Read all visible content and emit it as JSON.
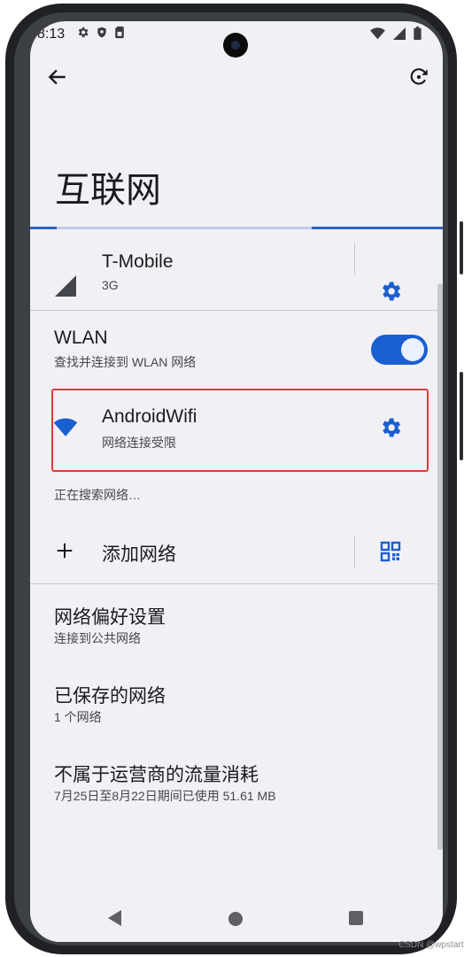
{
  "status_bar": {
    "time": "8:13",
    "left_icons": [
      "gear-icon",
      "shield-icon",
      "sim-card-icon"
    ],
    "right_icons": [
      "wifi-icon",
      "cellular-signal-icon",
      "battery-icon"
    ]
  },
  "toolbar": {
    "back_icon": "arrow-back-icon",
    "help_icon": "help-refresh-icon"
  },
  "page": {
    "title": "互联网"
  },
  "mobile_network": {
    "name": "T-Mobile",
    "subtitle": "3G",
    "signal_icon": "cellular-signal-icon",
    "settings_icon": "gear-icon"
  },
  "wlan": {
    "title": "WLAN",
    "subtitle": "查找并连接到 WLAN 网络",
    "toggle_on": true
  },
  "current_network": {
    "name": "AndroidWifi",
    "subtitle": "网络连接受限",
    "icon": "wifi-icon",
    "settings_icon": "gear-icon"
  },
  "searching_text": "正在搜索网络…",
  "add_network": {
    "label": "添加网络",
    "plus_icon": "plus-icon",
    "qr_icon": "qr-code-scan-icon"
  },
  "preferences": [
    {
      "title": "网络偏好设置",
      "subtitle": "连接到公共网络"
    },
    {
      "title": "已保存的网络",
      "subtitle": "1 个网络"
    },
    {
      "title": "不属于运营商的流量消耗",
      "subtitle": "7月25日至8月22日期间已使用 51.61 MB"
    }
  ],
  "nav_bar": {
    "back": "nav-back-icon",
    "home": "nav-home-icon",
    "recents": "nav-recents-icon"
  },
  "watermark": "CSDN @wpstart",
  "colors": {
    "accent": "#1a5fd0",
    "screen_bg": "#f1f0f4",
    "highlight_border": "#e53935"
  }
}
